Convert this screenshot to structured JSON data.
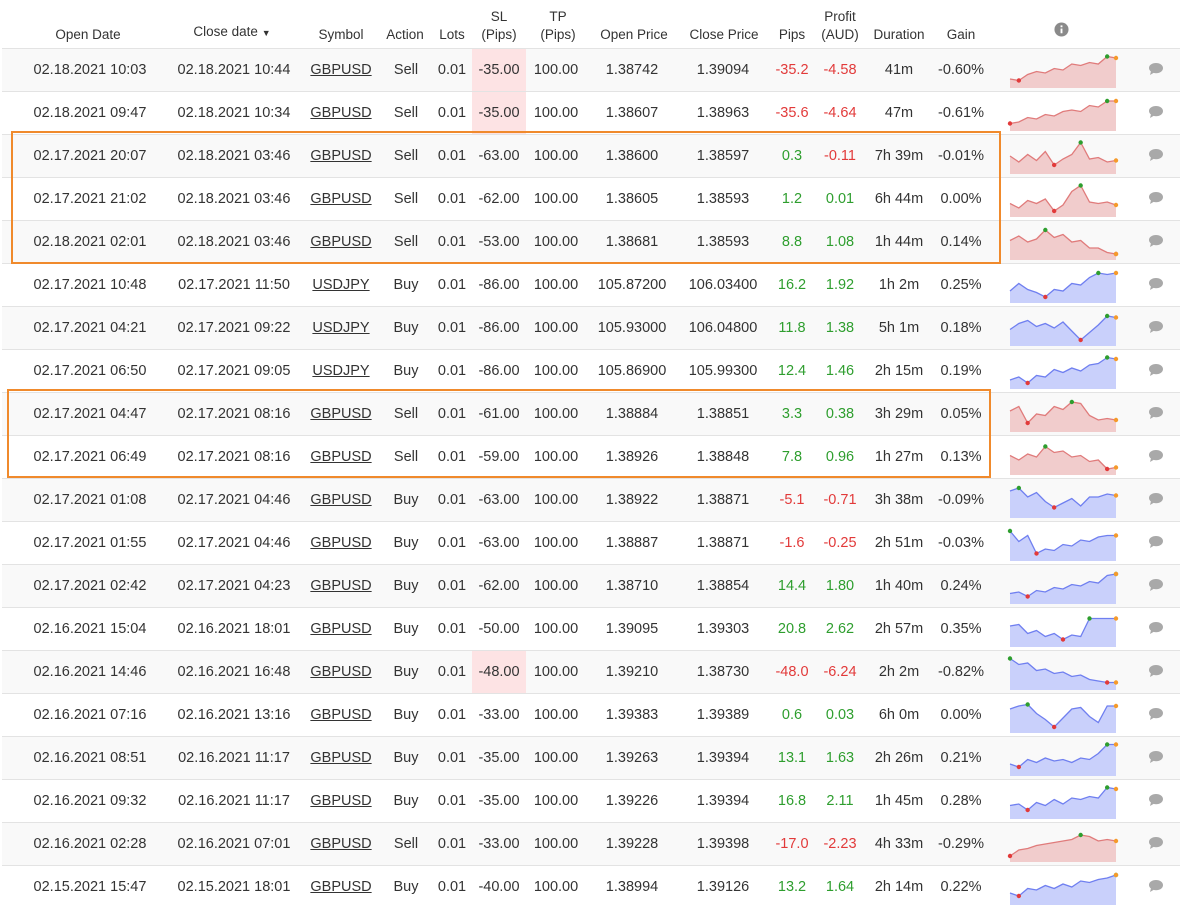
{
  "header": {
    "open_date": "Open Date",
    "close_date": "Close date",
    "close_date_sort": "▼",
    "symbol": "Symbol",
    "action": "Action",
    "lots": "Lots",
    "sl": "SL",
    "sl_unit": "(Pips)",
    "tp": "TP",
    "tp_unit": "(Pips)",
    "open_price": "Open Price",
    "close_price": "Close Price",
    "pips": "Pips",
    "profit": "Profit",
    "profit_unit": "(AUD)",
    "duration": "Duration",
    "gain": "Gain",
    "info": "i"
  },
  "colors": {
    "positive": "#2e9e2e",
    "negative": "#e23a3a",
    "sell_chart": "#e07b7b",
    "buy_chart": "#6f7ff0",
    "highlight_box": "#f08a2c",
    "sl_highlight": "#fde3e4"
  },
  "icons": {
    "info": "info-icon",
    "comment": "comment-icon"
  },
  "trades": [
    {
      "open": "02.18.2021 10:03",
      "close": "02.18.2021 10:44",
      "symbol": "GBPUSD",
      "action": "Sell",
      "lots": "0.01",
      "sl": "-35.00",
      "sl_hl": true,
      "tp": "100.00",
      "open_price": "1.38742",
      "close_price": "1.39094",
      "pips": "-35.2",
      "profit": "-4.58",
      "duration": "41m",
      "gain": "-0.60%",
      "spark": [
        0.2,
        0.15,
        0.35,
        0.45,
        0.4,
        0.55,
        0.5,
        0.7,
        0.65,
        0.75,
        0.7,
        0.95,
        0.9
      ]
    },
    {
      "open": "02.18.2021 09:47",
      "close": "02.18.2021 10:34",
      "symbol": "GBPUSD",
      "action": "Sell",
      "lots": "0.01",
      "sl": "-35.00",
      "sl_hl": true,
      "tp": "100.00",
      "open_price": "1.38607",
      "close_price": "1.38963",
      "pips": "-35.6",
      "profit": "-4.64",
      "duration": "47m",
      "gain": "-0.61%",
      "spark": [
        0.15,
        0.2,
        0.35,
        0.3,
        0.45,
        0.4,
        0.55,
        0.6,
        0.55,
        0.75,
        0.7,
        0.9,
        0.9
      ]
    },
    {
      "open": "02.17.2021 20:07",
      "close": "02.18.2021 03:46",
      "symbol": "GBPUSD",
      "action": "Sell",
      "lots": "0.01",
      "sl": "-63.00",
      "sl_hl": false,
      "tp": "100.00",
      "open_price": "1.38600",
      "close_price": "1.38597",
      "pips": "0.3",
      "profit": "-0.11",
      "duration": "7h 39m",
      "gain": "-0.01%",
      "spark": [
        0.5,
        0.3,
        0.55,
        0.35,
        0.65,
        0.2,
        0.4,
        0.55,
        0.95,
        0.4,
        0.45,
        0.3,
        0.35
      ]
    },
    {
      "open": "02.17.2021 21:02",
      "close": "02.18.2021 03:46",
      "symbol": "GBPUSD",
      "action": "Sell",
      "lots": "0.01",
      "sl": "-62.00",
      "sl_hl": false,
      "tp": "100.00",
      "open_price": "1.38605",
      "close_price": "1.38593",
      "pips": "1.2",
      "profit": "0.01",
      "duration": "6h 44m",
      "gain": "0.00%",
      "spark": [
        0.35,
        0.2,
        0.45,
        0.35,
        0.5,
        0.1,
        0.3,
        0.75,
        0.95,
        0.4,
        0.35,
        0.4,
        0.3
      ]
    },
    {
      "open": "02.18.2021 02:01",
      "close": "02.18.2021 03:46",
      "symbol": "GBPUSD",
      "action": "Sell",
      "lots": "0.01",
      "sl": "-53.00",
      "sl_hl": false,
      "tp": "100.00",
      "open_price": "1.38681",
      "close_price": "1.38593",
      "pips": "8.8",
      "profit": "1.08",
      "duration": "1h 44m",
      "gain": "0.14%",
      "spark": [
        0.55,
        0.7,
        0.5,
        0.6,
        0.9,
        0.65,
        0.75,
        0.5,
        0.55,
        0.3,
        0.3,
        0.15,
        0.1
      ]
    },
    {
      "open": "02.17.2021 10:48",
      "close": "02.17.2021 11:50",
      "symbol": "USDJPY",
      "action": "Buy",
      "lots": "0.01",
      "sl": "-86.00",
      "sl_hl": false,
      "tp": "100.00",
      "open_price": "105.87200",
      "close_price": "106.03400",
      "pips": "16.2",
      "profit": "1.92",
      "duration": "1h 2m",
      "gain": "0.25%",
      "spark": [
        0.3,
        0.55,
        0.35,
        0.25,
        0.1,
        0.35,
        0.3,
        0.55,
        0.5,
        0.75,
        0.9,
        0.85,
        0.9
      ]
    },
    {
      "open": "02.17.2021 04:21",
      "close": "02.17.2021 09:22",
      "symbol": "USDJPY",
      "action": "Buy",
      "lots": "0.01",
      "sl": "-86.00",
      "sl_hl": false,
      "tp": "100.00",
      "open_price": "105.93000",
      "close_price": "106.04800",
      "pips": "11.8",
      "profit": "1.38",
      "duration": "5h 1m",
      "gain": "0.18%",
      "spark": [
        0.45,
        0.65,
        0.75,
        0.55,
        0.65,
        0.5,
        0.7,
        0.4,
        0.1,
        0.35,
        0.6,
        0.9,
        0.85
      ]
    },
    {
      "open": "02.17.2021 06:50",
      "close": "02.17.2021 09:05",
      "symbol": "USDJPY",
      "action": "Buy",
      "lots": "0.01",
      "sl": "-86.00",
      "sl_hl": false,
      "tp": "100.00",
      "open_price": "105.86900",
      "close_price": "105.99300",
      "pips": "12.4",
      "profit": "1.46",
      "duration": "2h 15m",
      "gain": "0.19%",
      "spark": [
        0.2,
        0.3,
        0.1,
        0.35,
        0.3,
        0.55,
        0.45,
        0.6,
        0.5,
        0.7,
        0.75,
        0.95,
        0.9
      ]
    },
    {
      "open": "02.17.2021 04:47",
      "close": "02.17.2021 08:16",
      "symbol": "GBPUSD",
      "action": "Sell",
      "lots": "0.01",
      "sl": "-61.00",
      "sl_hl": false,
      "tp": "100.00",
      "open_price": "1.38884",
      "close_price": "1.38851",
      "pips": "3.3",
      "profit": "0.38",
      "duration": "3h 29m",
      "gain": "0.05%",
      "spark": [
        0.6,
        0.75,
        0.2,
        0.5,
        0.45,
        0.75,
        0.65,
        0.9,
        0.85,
        0.45,
        0.3,
        0.35,
        0.3
      ]
    },
    {
      "open": "02.17.2021 06:49",
      "close": "02.17.2021 08:16",
      "symbol": "GBPUSD",
      "action": "Sell",
      "lots": "0.01",
      "sl": "-59.00",
      "sl_hl": false,
      "tp": "100.00",
      "open_price": "1.38926",
      "close_price": "1.38848",
      "pips": "7.8",
      "profit": "0.96",
      "duration": "1h 27m",
      "gain": "0.13%",
      "spark": [
        0.55,
        0.4,
        0.6,
        0.5,
        0.85,
        0.65,
        0.7,
        0.5,
        0.55,
        0.35,
        0.4,
        0.1,
        0.15
      ]
    },
    {
      "open": "02.17.2021 01:08",
      "close": "02.17.2021 04:46",
      "symbol": "GBPUSD",
      "action": "Buy",
      "lots": "0.01",
      "sl": "-63.00",
      "sl_hl": false,
      "tp": "100.00",
      "open_price": "1.38922",
      "close_price": "1.38871",
      "pips": "-5.1",
      "profit": "-0.71",
      "duration": "3h 38m",
      "gain": "-0.09%",
      "spark": [
        0.8,
        0.9,
        0.6,
        0.75,
        0.45,
        0.25,
        0.4,
        0.55,
        0.3,
        0.6,
        0.6,
        0.7,
        0.65
      ]
    },
    {
      "open": "02.17.2021 01:55",
      "close": "02.17.2021 04:46",
      "symbol": "GBPUSD",
      "action": "Buy",
      "lots": "0.01",
      "sl": "-63.00",
      "sl_hl": false,
      "tp": "100.00",
      "open_price": "1.38887",
      "close_price": "1.38871",
      "pips": "-1.6",
      "profit": "-0.25",
      "duration": "2h 51m",
      "gain": "-0.03%",
      "spark": [
        0.9,
        0.55,
        0.75,
        0.15,
        0.3,
        0.25,
        0.45,
        0.4,
        0.6,
        0.55,
        0.7,
        0.75,
        0.75
      ]
    },
    {
      "open": "02.17.2021 02:42",
      "close": "02.17.2021 04:23",
      "symbol": "GBPUSD",
      "action": "Buy",
      "lots": "0.01",
      "sl": "-62.00",
      "sl_hl": false,
      "tp": "100.00",
      "open_price": "1.38710",
      "close_price": "1.38854",
      "pips": "14.4",
      "profit": "1.80",
      "duration": "1h 40m",
      "gain": "0.24%",
      "spark": [
        0.25,
        0.3,
        0.15,
        0.35,
        0.3,
        0.45,
        0.4,
        0.55,
        0.5,
        0.65,
        0.6,
        0.85,
        0.9
      ]
    },
    {
      "open": "02.16.2021 15:04",
      "close": "02.16.2021 18:01",
      "symbol": "GBPUSD",
      "action": "Buy",
      "lots": "0.01",
      "sl": "-50.00",
      "sl_hl": false,
      "tp": "100.00",
      "open_price": "1.39095",
      "close_price": "1.39303",
      "pips": "20.8",
      "profit": "2.62",
      "duration": "2h 57m",
      "gain": "0.35%",
      "spark": [
        0.6,
        0.65,
        0.35,
        0.45,
        0.25,
        0.35,
        0.15,
        0.3,
        0.25,
        0.85,
        0.85,
        0.85,
        0.85
      ]
    },
    {
      "open": "02.16.2021 14:46",
      "close": "02.16.2021 16:48",
      "symbol": "GBPUSD",
      "action": "Buy",
      "lots": "0.01",
      "sl": "-48.00",
      "sl_hl": true,
      "tp": "100.00",
      "open_price": "1.39210",
      "close_price": "1.38730",
      "pips": "-48.0",
      "profit": "-6.24",
      "duration": "2h 2m",
      "gain": "-0.82%",
      "spark": [
        0.95,
        0.75,
        0.8,
        0.55,
        0.6,
        0.45,
        0.5,
        0.35,
        0.4,
        0.25,
        0.2,
        0.15,
        0.15
      ]
    },
    {
      "open": "02.16.2021 07:16",
      "close": "02.16.2021 13:16",
      "symbol": "GBPUSD",
      "action": "Buy",
      "lots": "0.01",
      "sl": "-33.00",
      "sl_hl": false,
      "tp": "100.00",
      "open_price": "1.39383",
      "close_price": "1.39389",
      "pips": "0.6",
      "profit": "0.03",
      "duration": "6h 0m",
      "gain": "0.00%",
      "spark": [
        0.7,
        0.8,
        0.85,
        0.55,
        0.35,
        0.1,
        0.4,
        0.7,
        0.75,
        0.45,
        0.25,
        0.8,
        0.8
      ]
    },
    {
      "open": "02.16.2021 08:51",
      "close": "02.16.2021 11:17",
      "symbol": "GBPUSD",
      "action": "Buy",
      "lots": "0.01",
      "sl": "-35.00",
      "sl_hl": false,
      "tp": "100.00",
      "open_price": "1.39263",
      "close_price": "1.39394",
      "pips": "13.1",
      "profit": "1.63",
      "duration": "2h 26m",
      "gain": "0.21%",
      "spark": [
        0.3,
        0.2,
        0.45,
        0.35,
        0.5,
        0.4,
        0.45,
        0.35,
        0.5,
        0.45,
        0.65,
        0.95,
        0.95
      ]
    },
    {
      "open": "02.16.2021 09:32",
      "close": "02.16.2021 11:17",
      "symbol": "GBPUSD",
      "action": "Buy",
      "lots": "0.01",
      "sl": "-35.00",
      "sl_hl": false,
      "tp": "100.00",
      "open_price": "1.39226",
      "close_price": "1.39394",
      "pips": "16.8",
      "profit": "2.11",
      "duration": "1h 45m",
      "gain": "0.28%",
      "spark": [
        0.35,
        0.4,
        0.2,
        0.45,
        0.35,
        0.55,
        0.4,
        0.6,
        0.55,
        0.65,
        0.6,
        0.95,
        0.9
      ]
    },
    {
      "open": "02.16.2021 02:28",
      "close": "02.16.2021 07:01",
      "symbol": "GBPUSD",
      "action": "Sell",
      "lots": "0.01",
      "sl": "-33.00",
      "sl_hl": false,
      "tp": "100.00",
      "open_price": "1.39228",
      "close_price": "1.39398",
      "pips": "-17.0",
      "profit": "-2.23",
      "duration": "4h 33m",
      "gain": "-0.29%",
      "spark": [
        0.1,
        0.3,
        0.35,
        0.45,
        0.5,
        0.55,
        0.6,
        0.65,
        0.8,
        0.75,
        0.6,
        0.65,
        0.6
      ]
    },
    {
      "open": "02.15.2021 15:47",
      "close": "02.15.2021 18:01",
      "symbol": "GBPUSD",
      "action": "Buy",
      "lots": "0.01",
      "sl": "-40.00",
      "sl_hl": false,
      "tp": "100.00",
      "open_price": "1.38994",
      "close_price": "1.39126",
      "pips": "13.2",
      "profit": "1.64",
      "duration": "2h 14m",
      "gain": "0.22%",
      "spark": [
        0.3,
        0.2,
        0.45,
        0.4,
        0.55,
        0.45,
        0.6,
        0.5,
        0.7,
        0.65,
        0.75,
        0.8,
        0.9
      ]
    }
  ],
  "highlight_groups": [
    {
      "label": "group-1",
      "rows": [
        2,
        4
      ]
    },
    {
      "label": "group-2",
      "rows": [
        8,
        9
      ]
    }
  ]
}
